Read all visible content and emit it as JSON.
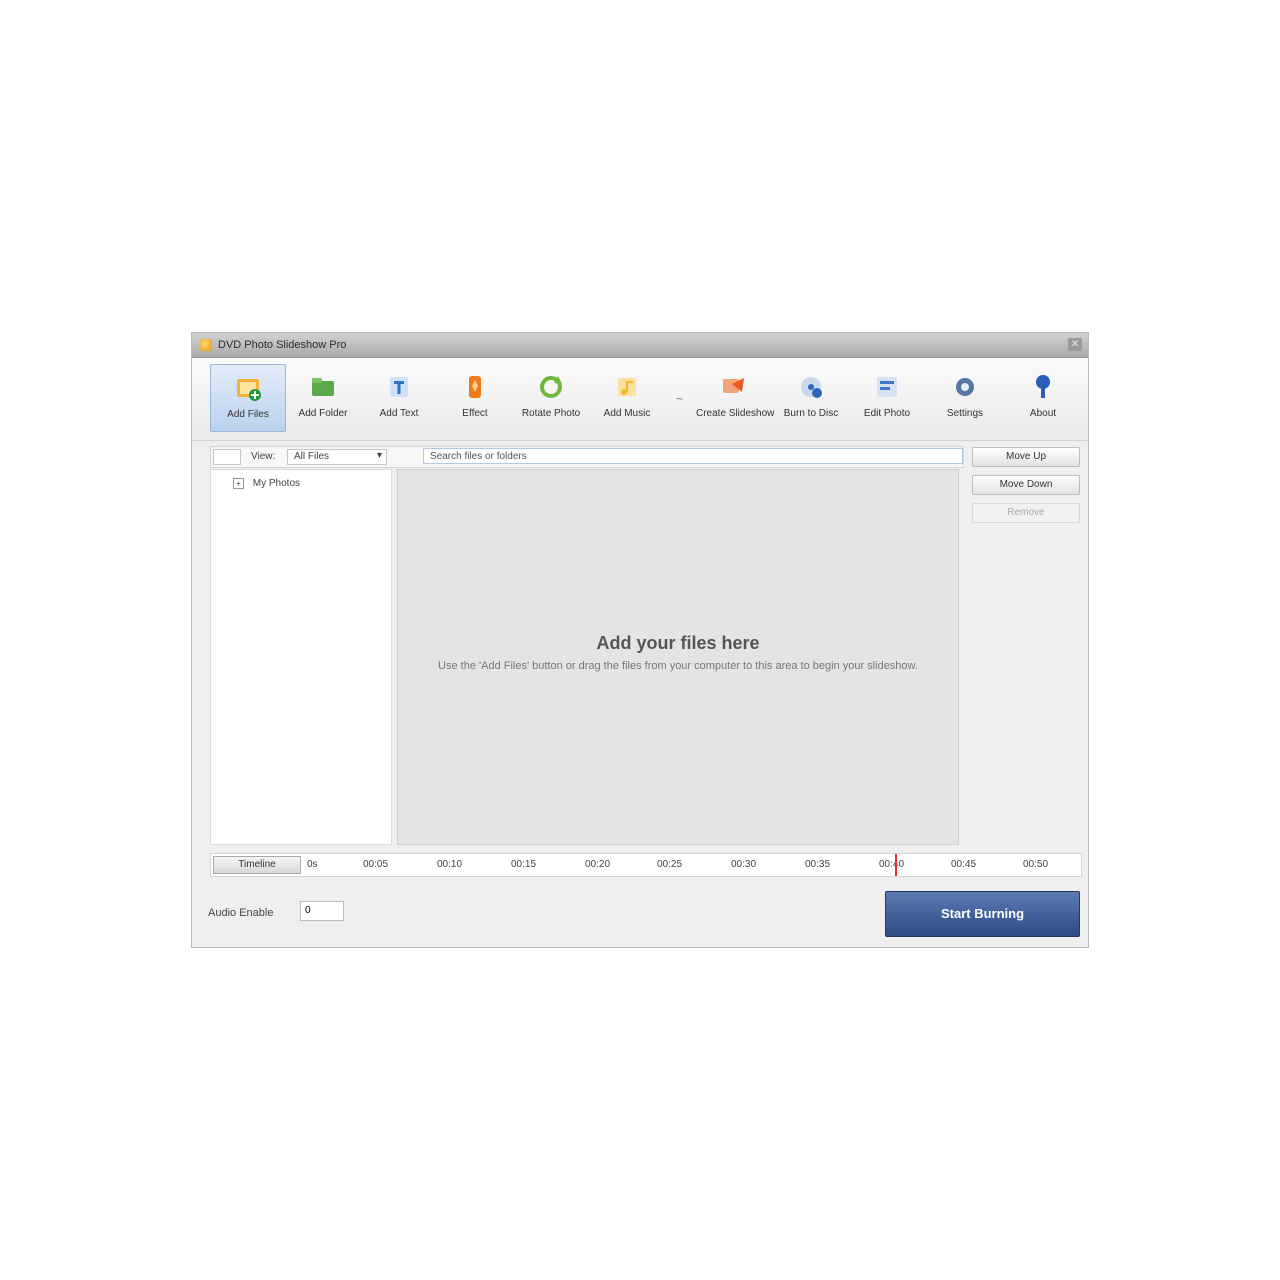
{
  "window": {
    "title": "DVD Photo Slideshow Pro"
  },
  "toolbar": {
    "buttons": [
      {
        "label": "Add Files",
        "icon": "add-files-icon",
        "color": "#f0a020"
      },
      {
        "label": "Add Folder",
        "icon": "add-folder-icon",
        "color": "#3f9a38"
      },
      {
        "label": "Add Text",
        "icon": "add-text-icon",
        "color": "#2a72c8"
      },
      {
        "label": "Effect",
        "icon": "effect-icon",
        "color": "#f07a1a"
      },
      {
        "label": "Rotate Photo",
        "icon": "rotate-photo-icon",
        "color": "#6fb83a"
      },
      {
        "label": "Add Music",
        "icon": "add-music-icon",
        "color": "#f1b62e"
      },
      {
        "label": "Create Slideshow",
        "icon": "create-slideshow-icon",
        "color": "#e75a24"
      },
      {
        "label": "Burn to Disc",
        "icon": "burn-to-disc-icon",
        "color": "#2f67b8"
      },
      {
        "label": "Edit Photo",
        "icon": "edit-photo-icon",
        "color": "#3f77c8"
      },
      {
        "label": "Settings",
        "icon": "settings-icon",
        "color": "#5677a3"
      },
      {
        "label": "About",
        "icon": "about-icon",
        "color": "#2a5db5"
      }
    ],
    "separator": "~"
  },
  "filter": {
    "view_label": "View:",
    "view_value": "All Files",
    "search_placeholder": "Search files or folders"
  },
  "tree": {
    "root_label": "My Photos",
    "expander": "+"
  },
  "content": {
    "title": "Add your files here",
    "hint": "Use the 'Add Files' button or drag the files from your computer to this area to begin your slideshow."
  },
  "side_buttons": {
    "move_up": "Move Up",
    "move_down": "Move Down",
    "remove": "Remove"
  },
  "timeline": {
    "button_label": "Timeline",
    "ticks": [
      "0s",
      "00:05",
      "00:10",
      "00:15",
      "00:20",
      "00:25",
      "00:30",
      "00:35",
      "00:40",
      "00:45",
      "00:50"
    ]
  },
  "bottom": {
    "audio_label": "Audio Enable",
    "audio_value": "0",
    "start_label": "Start Burning"
  }
}
